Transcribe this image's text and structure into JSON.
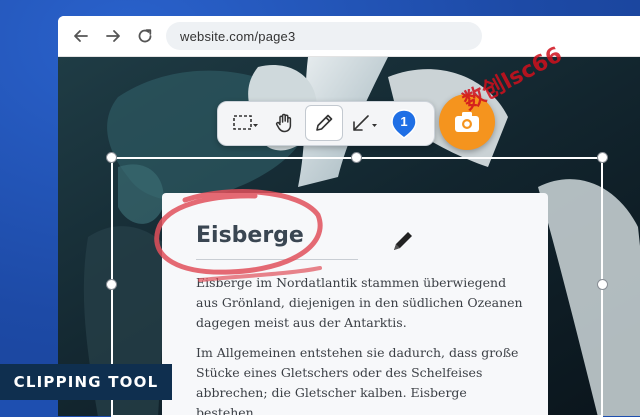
{
  "browser": {
    "url": "website.com/page3",
    "nav": [
      "back-arrow-icon",
      "forward-arrow-icon",
      "reload-icon"
    ]
  },
  "toolbar": {
    "tools": [
      {
        "name": "rectangle-select-tool",
        "icon": "dashed-rectangle-icon"
      },
      {
        "name": "pan-tool",
        "icon": "hand-icon"
      },
      {
        "name": "pen-tool",
        "icon": "pencil-icon",
        "active": true
      },
      {
        "name": "arrow-tool",
        "icon": "arrow-icon"
      },
      {
        "name": "step-marker-tool",
        "icon": "badge-icon"
      }
    ],
    "badge_number": "1",
    "camera_icon": "camera-icon"
  },
  "article": {
    "title": "Eisberge",
    "paragraph1": "Eisberge im Nordatlantik stammen überwiegend aus Grönland, diejenigen in den südlichen Ozeanen dagegen meist aus der Antarktis.",
    "paragraph2": "Im Allgemeinen entstehen sie dadurch, dass große Stücke eines Gletschers oder des Schelfeises abbrechen; die Gletscher kalben. Eisberge bestehen"
  },
  "watermark": "数创lsc66",
  "label": "CLIPPING TOOL",
  "colors": {
    "background_blue": "#1e4fb0",
    "accent_orange": "#f5941e",
    "badge_blue": "#1f6fe5",
    "annotation_red": "#e0505a",
    "label_navy": "#0f2f4f"
  }
}
